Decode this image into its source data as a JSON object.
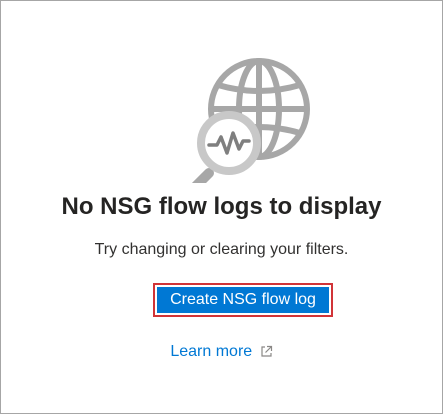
{
  "empty_state": {
    "title": "No NSG flow logs to display",
    "subtitle": "Try changing or clearing your filters.",
    "primary_button_label": "Create NSG flow log",
    "learn_more_label": "Learn more"
  },
  "icons": {
    "illustration": "globe-with-magnifier-icon",
    "learn_more": "external-link-icon"
  },
  "colors": {
    "accent": "#0078d4",
    "highlight_border": "#d13438",
    "text_primary": "#252423",
    "text_secondary": "#323130",
    "globe": "#a7a7a7"
  }
}
